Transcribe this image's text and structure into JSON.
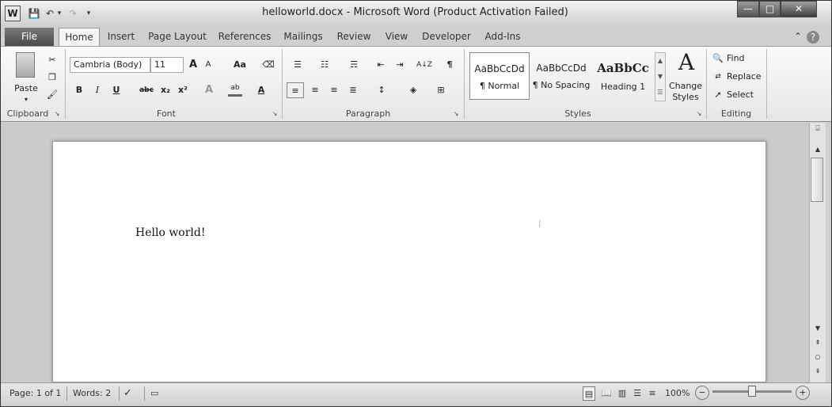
{
  "window": {
    "title": "helloworld.docx  -  Microsoft Word (Product Activation Failed)",
    "app_icon": "W",
    "minimize": "—",
    "maximize": "□",
    "close": "✕"
  },
  "qat": {
    "save": "💾",
    "undo": "↶",
    "undo_drop": "▾",
    "redo": "↷",
    "customize": "▾"
  },
  "tabs": {
    "file": "File",
    "home": "Home",
    "insert": "Insert",
    "page_layout": "Page Layout",
    "references": "References",
    "mailings": "Mailings",
    "review": "Review",
    "view": "View",
    "developer": "Developer",
    "add_ins": "Add-Ins"
  },
  "ribbon_right": {
    "collapse": "⌃",
    "help": "?"
  },
  "clipboard": {
    "paste": "Paste",
    "paste_arrow": "▾",
    "label": "Clipboard"
  },
  "font": {
    "name": "Cambria (Body)",
    "size": "11",
    "grow": "A",
    "shrink": "A",
    "case": "Aa",
    "bold": "B",
    "italic": "I",
    "underline": "U",
    "strike": "abc",
    "subscript": "x₂",
    "superscript": "x²",
    "text_effects": "A",
    "highlight": "ab",
    "font_color": "A",
    "label": "Font"
  },
  "paragraph": {
    "sort": "A↓Z",
    "pilcrow": "¶",
    "label": "Paragraph"
  },
  "styles": {
    "items": [
      {
        "sample": "AaBbCcDd",
        "name": "¶ Normal"
      },
      {
        "sample": "AaBbCcDd",
        "name": "¶ No Spacing"
      },
      {
        "sample": "AaBbCc",
        "name": "Heading 1"
      }
    ],
    "change_styles": "Change Styles",
    "change_icon": "A",
    "label": "Styles"
  },
  "editing": {
    "find": "Find",
    "replace": "Replace",
    "select": "Select",
    "label": "Editing"
  },
  "document": {
    "text": "Hello world!"
  },
  "status": {
    "page": "Page: 1 of 1",
    "words": "Words: 2",
    "zoom": "100%",
    "zoom_out": "−",
    "zoom_in": "+"
  }
}
